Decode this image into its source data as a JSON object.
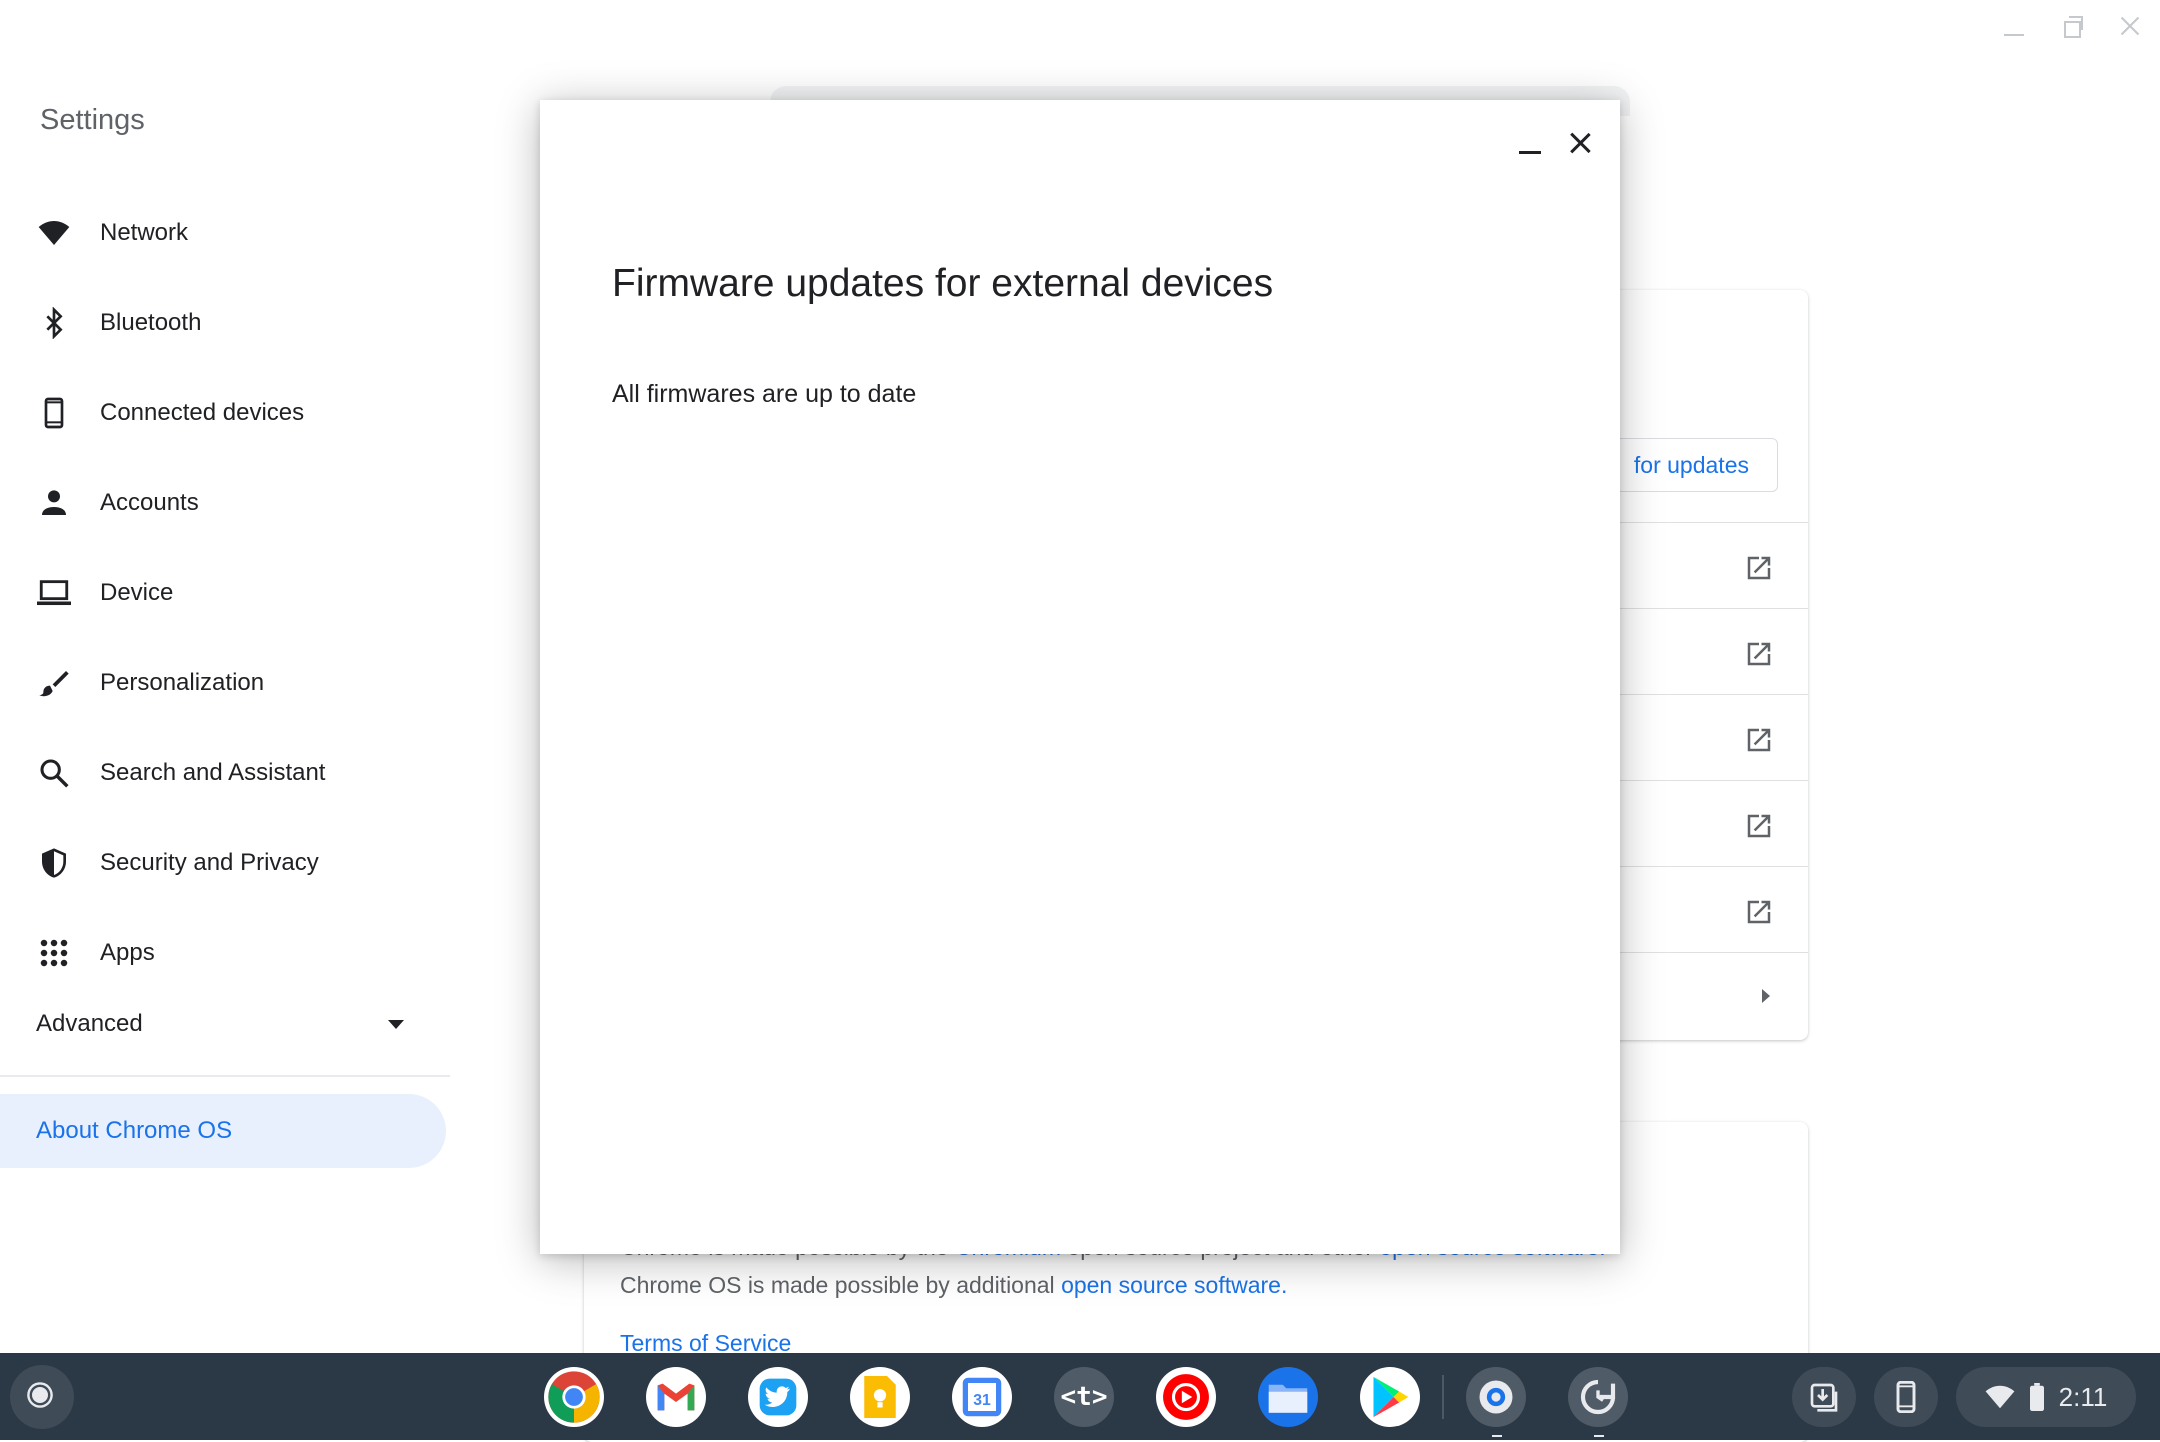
{
  "sidebar": {
    "title": "Settings",
    "items": [
      {
        "label": "Network",
        "icon": "wifi-icon"
      },
      {
        "label": "Bluetooth",
        "icon": "bluetooth-icon"
      },
      {
        "label": "Connected devices",
        "icon": "phone-icon"
      },
      {
        "label": "Accounts",
        "icon": "person-icon"
      },
      {
        "label": "Device",
        "icon": "laptop-icon"
      },
      {
        "label": "Personalization",
        "icon": "brush-icon"
      },
      {
        "label": "Search and Assistant",
        "icon": "search-icon"
      },
      {
        "label": "Security and Privacy",
        "icon": "shield-icon"
      },
      {
        "label": "Apps",
        "icon": "apps-grid-icon"
      }
    ],
    "advanced_label": "Advanced",
    "about_label": "About Chrome OS"
  },
  "background": {
    "check_updates_label": "for updates",
    "line1_pre": "Chrome is made possible by the ",
    "line1_link": "Chromium",
    "line1_mid": " open source project and other ",
    "line1_link2": "open source software.",
    "line2_pre": "Chrome OS is made possible by additional ",
    "line2_link": "open source software.",
    "terms_label": "Terms of Service"
  },
  "dialog": {
    "title": "Firmware updates for external devices",
    "status": "All firmwares are up to date"
  },
  "shelf": {
    "apps": [
      {
        "name": "chrome-app-icon",
        "glyph": "",
        "color": "#ffffff"
      },
      {
        "name": "gmail-app-icon",
        "glyph": "M",
        "color": "#ffffff"
      },
      {
        "name": "twitter-app-icon",
        "glyph": "",
        "color": "#ffffff"
      },
      {
        "name": "keep-app-icon",
        "glyph": "",
        "color": "#fbbc04"
      },
      {
        "name": "calendar-app-icon",
        "glyph": "31",
        "color": "#ffffff"
      },
      {
        "name": "text-app-icon",
        "glyph": "<t>",
        "color": "#4f5b66"
      },
      {
        "name": "youtube-music-app-icon",
        "glyph": "",
        "color": "#ff0000"
      },
      {
        "name": "files-app-icon",
        "glyph": "",
        "color": "#1a73e8"
      },
      {
        "name": "play-store-app-icon",
        "glyph": "",
        "color": "#ffffff"
      }
    ],
    "time": "2:11"
  }
}
